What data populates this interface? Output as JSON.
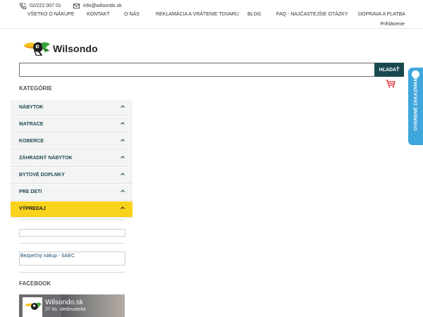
{
  "header": {
    "phone": "02/222 007 01",
    "email": "info@wilsondo.sk",
    "nav": [
      "VŠETKO O NÁKUPE",
      "KONTAKT",
      "O NÁS",
      "REKLAMÁCIA A VRÁTENIE TOVARU",
      "BLOG",
      "FAQ - NAJČASTEJŠIE OTÁZKY",
      "DOPRAVA A PLATBA"
    ],
    "login": "Prihlásenie"
  },
  "logo": {
    "text": "Wilsondo"
  },
  "search": {
    "value": "",
    "placeholder": "",
    "button": "HĽADAŤ"
  },
  "sidebar": {
    "title": "KATEGÓRIE",
    "categories": [
      "NÁBYTOK",
      "MATRACE",
      "KOBERCE",
      "ZÁHRADNÝ NÁBYTOK",
      "BYTOVÉ DOPLNKY",
      "PRE DETI",
      "VÝPREDAJ"
    ],
    "secure_link": "Bezpečný nákup - SAEC",
    "facebook_title": "FACEBOOK"
  },
  "facebook": {
    "name": "Wilsondo.sk",
    "followers": "27 tis. sledovatelia"
  },
  "verified_badge": "OVERENÉ ZÁKAZNÍKMI",
  "colors": {
    "brand_dark": "#19494f",
    "sale": "#f9d21b",
    "badge": "#3fa7dc"
  }
}
